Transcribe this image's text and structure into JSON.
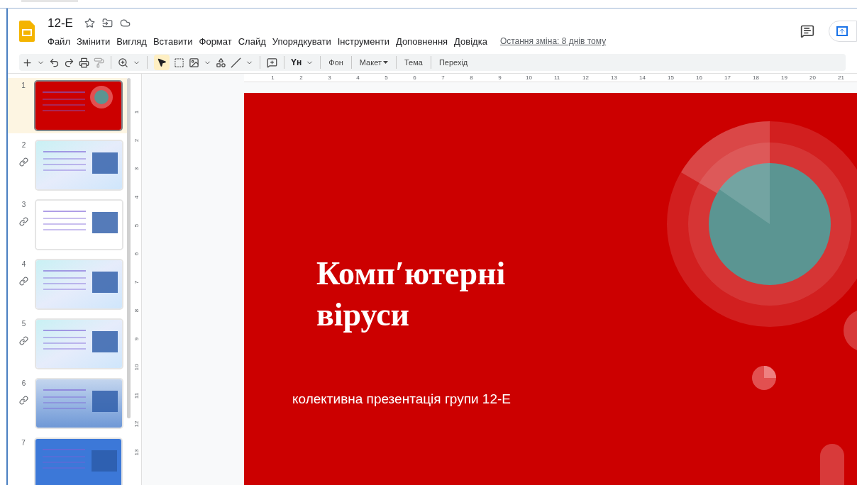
{
  "document": {
    "title": "12-E"
  },
  "menu": [
    "Файл",
    "Змінити",
    "Вигляд",
    "Вставити",
    "Формат",
    "Слайд",
    "Упорядкувати",
    "Інструменти",
    "Доповнення",
    "Довідка"
  ],
  "last_edit": "Остання зміна: 8 днів тому",
  "toolbar": {
    "input_tools": "Yн",
    "buttons": [
      "Фон",
      "Макет",
      "Тема",
      "Перехід"
    ],
    "select_tool_selected": true
  },
  "slides": [
    {
      "number": "1",
      "selected": true,
      "linked": false,
      "kind": "red"
    },
    {
      "number": "2",
      "selected": false,
      "linked": true,
      "kind": "pastel"
    },
    {
      "number": "3",
      "selected": false,
      "linked": true,
      "kind": "white"
    },
    {
      "number": "4",
      "selected": false,
      "linked": true,
      "kind": "pastel"
    },
    {
      "number": "5",
      "selected": false,
      "linked": true,
      "kind": "pastel"
    },
    {
      "number": "6",
      "selected": false,
      "linked": true,
      "kind": "gradient"
    },
    {
      "number": "7",
      "selected": false,
      "linked": false,
      "kind": "blue"
    }
  ],
  "ruler": {
    "horizontal": [
      "1",
      "2",
      "3",
      "4",
      "5",
      "6",
      "7",
      "8",
      "9",
      "10",
      "11",
      "12",
      "13",
      "14",
      "15",
      "16",
      "17",
      "18",
      "19",
      "20",
      "21"
    ],
    "vertical": [
      "1",
      "2",
      "3",
      "4",
      "5",
      "6",
      "7",
      "8",
      "9",
      "10",
      "11",
      "12",
      "13"
    ]
  },
  "slide": {
    "title": "Комп′ютерні віруси",
    "subtitle": "колективна презентація групи 12-Е"
  }
}
